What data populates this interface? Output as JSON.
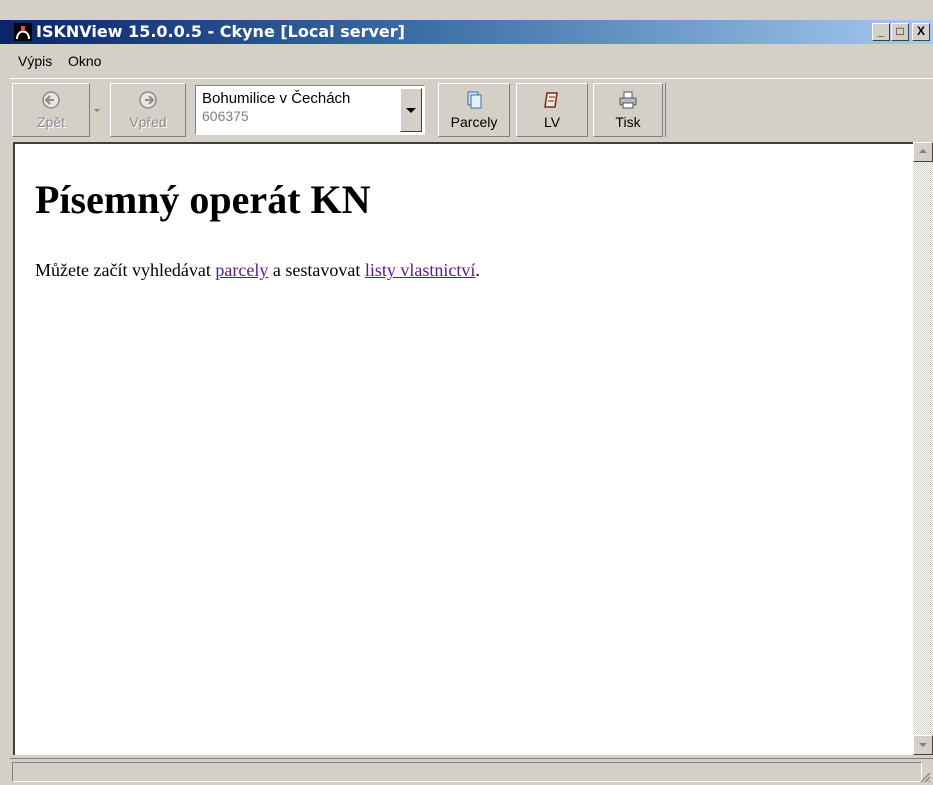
{
  "window": {
    "title": "ISKNView 15.0.0.5 - Ckyne [Local server]",
    "controls": {
      "minimize": "_",
      "maximize": "□",
      "close": "X"
    }
  },
  "menu": {
    "items": [
      "Výpis",
      "Okno"
    ]
  },
  "toolbar": {
    "back_label": "Zpět",
    "forward_label": "Vpřed",
    "location": {
      "name": "Bohumilice v Čechách",
      "code": "606375"
    },
    "parcely_label": "Parcely",
    "lv_label": "LV",
    "tisk_label": "Tisk"
  },
  "content": {
    "title": "Písemný operát KN",
    "intro_before": "Můžete začít vyhledávat ",
    "link_parcely": "parcely",
    "intro_middle": " a sestavovat ",
    "link_listy": "listy vlastnictví",
    "intro_after": "."
  },
  "colors": {
    "titlebar_start": "#0a246a",
    "titlebar_end": "#a6caf0",
    "link_visited": "#551a8b",
    "chrome": "#d4d0c8"
  }
}
